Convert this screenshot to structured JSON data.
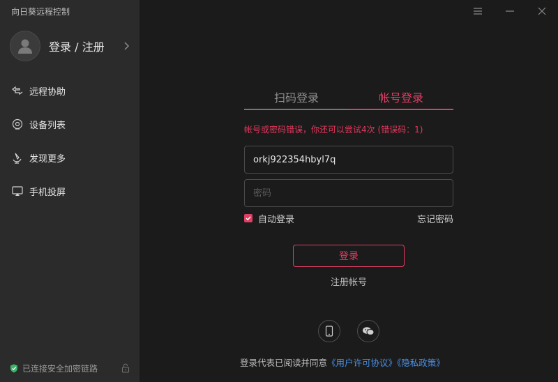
{
  "app": {
    "title": "向日葵远程控制"
  },
  "sidebar": {
    "user_label": "登录 / 注册",
    "items": [
      {
        "label": "远程协助",
        "icon": "remote-assist-icon"
      },
      {
        "label": "设备列表",
        "icon": "device-list-icon"
      },
      {
        "label": "发现更多",
        "icon": "discover-icon"
      },
      {
        "label": "手机投屏",
        "icon": "screen-cast-icon"
      }
    ],
    "status_text": "已连接安全加密链路"
  },
  "tabs": {
    "qr_label": "扫码登录",
    "account_label": "帐号登录",
    "active": "account"
  },
  "form": {
    "error": "帐号或密码错误，你还可以尝试4次 (错误码：1)",
    "username_value": "orkj922354hbyl7q",
    "password_placeholder": "密码",
    "remember_label": "自动登录",
    "remember_checked": true,
    "forgot_label": "忘记密码",
    "login_label": "登录",
    "register_label": "注册帐号"
  },
  "agreement": {
    "prefix": "登录代表已阅读并同意",
    "license_link": "《用户许可协议》",
    "privacy_link": "《隐私政策》"
  },
  "colors": {
    "accent": "#e23d63",
    "link": "#4a8fe6",
    "sidebar_bg": "#2b2b2b",
    "main_bg": "#1b1b1b"
  }
}
